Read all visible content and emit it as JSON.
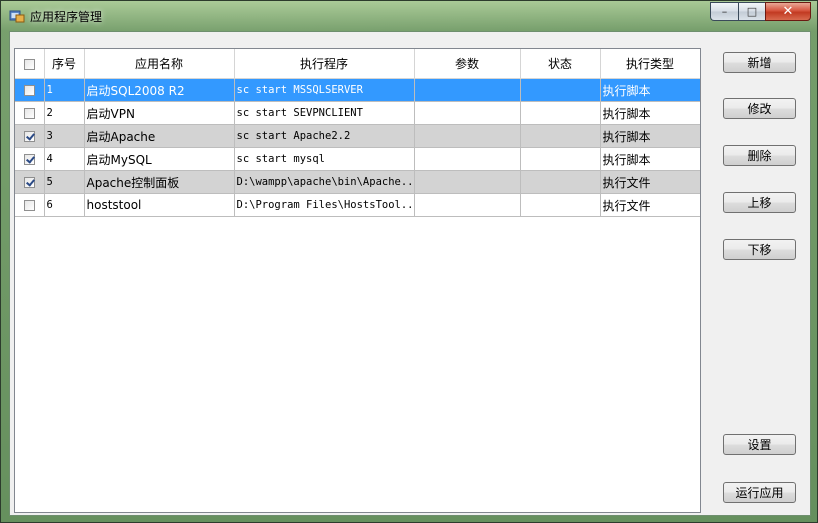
{
  "window": {
    "title": "应用程序管理",
    "minimize_glyph": "–",
    "maximize_glyph": "□",
    "close_glyph": "✕"
  },
  "table": {
    "headers": [
      "",
      "序号",
      "应用名称",
      "执行程序",
      "参数",
      "状态",
      "执行类型"
    ],
    "rows": [
      {
        "checked": false,
        "selected": true,
        "shade": "sel",
        "cells": [
          "1",
          "启动SQL2008 R2",
          "sc start MSSQLSERVER",
          "",
          "",
          "执行脚本"
        ]
      },
      {
        "checked": false,
        "selected": false,
        "shade": "white",
        "cells": [
          "2",
          "启动VPN",
          "sc start SEVPNCLIENT",
          "",
          "",
          "执行脚本"
        ]
      },
      {
        "checked": true,
        "selected": false,
        "shade": "gray",
        "cells": [
          "3",
          "启动Apache",
          "sc start Apache2.2",
          "",
          "",
          "执行脚本"
        ]
      },
      {
        "checked": true,
        "selected": false,
        "shade": "white",
        "cells": [
          "4",
          "启动MySQL",
          "sc start mysql",
          "",
          "",
          "执行脚本"
        ]
      },
      {
        "checked": true,
        "selected": false,
        "shade": "gray",
        "cells": [
          "5",
          "Apache控制面板",
          "D:\\wampp\\apache\\bin\\Apache...",
          "",
          "",
          "执行文件"
        ]
      },
      {
        "checked": false,
        "selected": false,
        "shade": "white",
        "cells": [
          "6",
          "hoststool",
          "D:\\Program Files\\HostsTool...",
          "",
          "",
          "执行文件"
        ]
      }
    ]
  },
  "buttons": {
    "add": "新增",
    "edit": "修改",
    "delete": "删除",
    "move_up": "上移",
    "move_down": "下移",
    "settings": "设置",
    "run": "运行应用"
  },
  "colors": {
    "selection": "#3399ff",
    "alt_row": "#d3d3d3"
  }
}
